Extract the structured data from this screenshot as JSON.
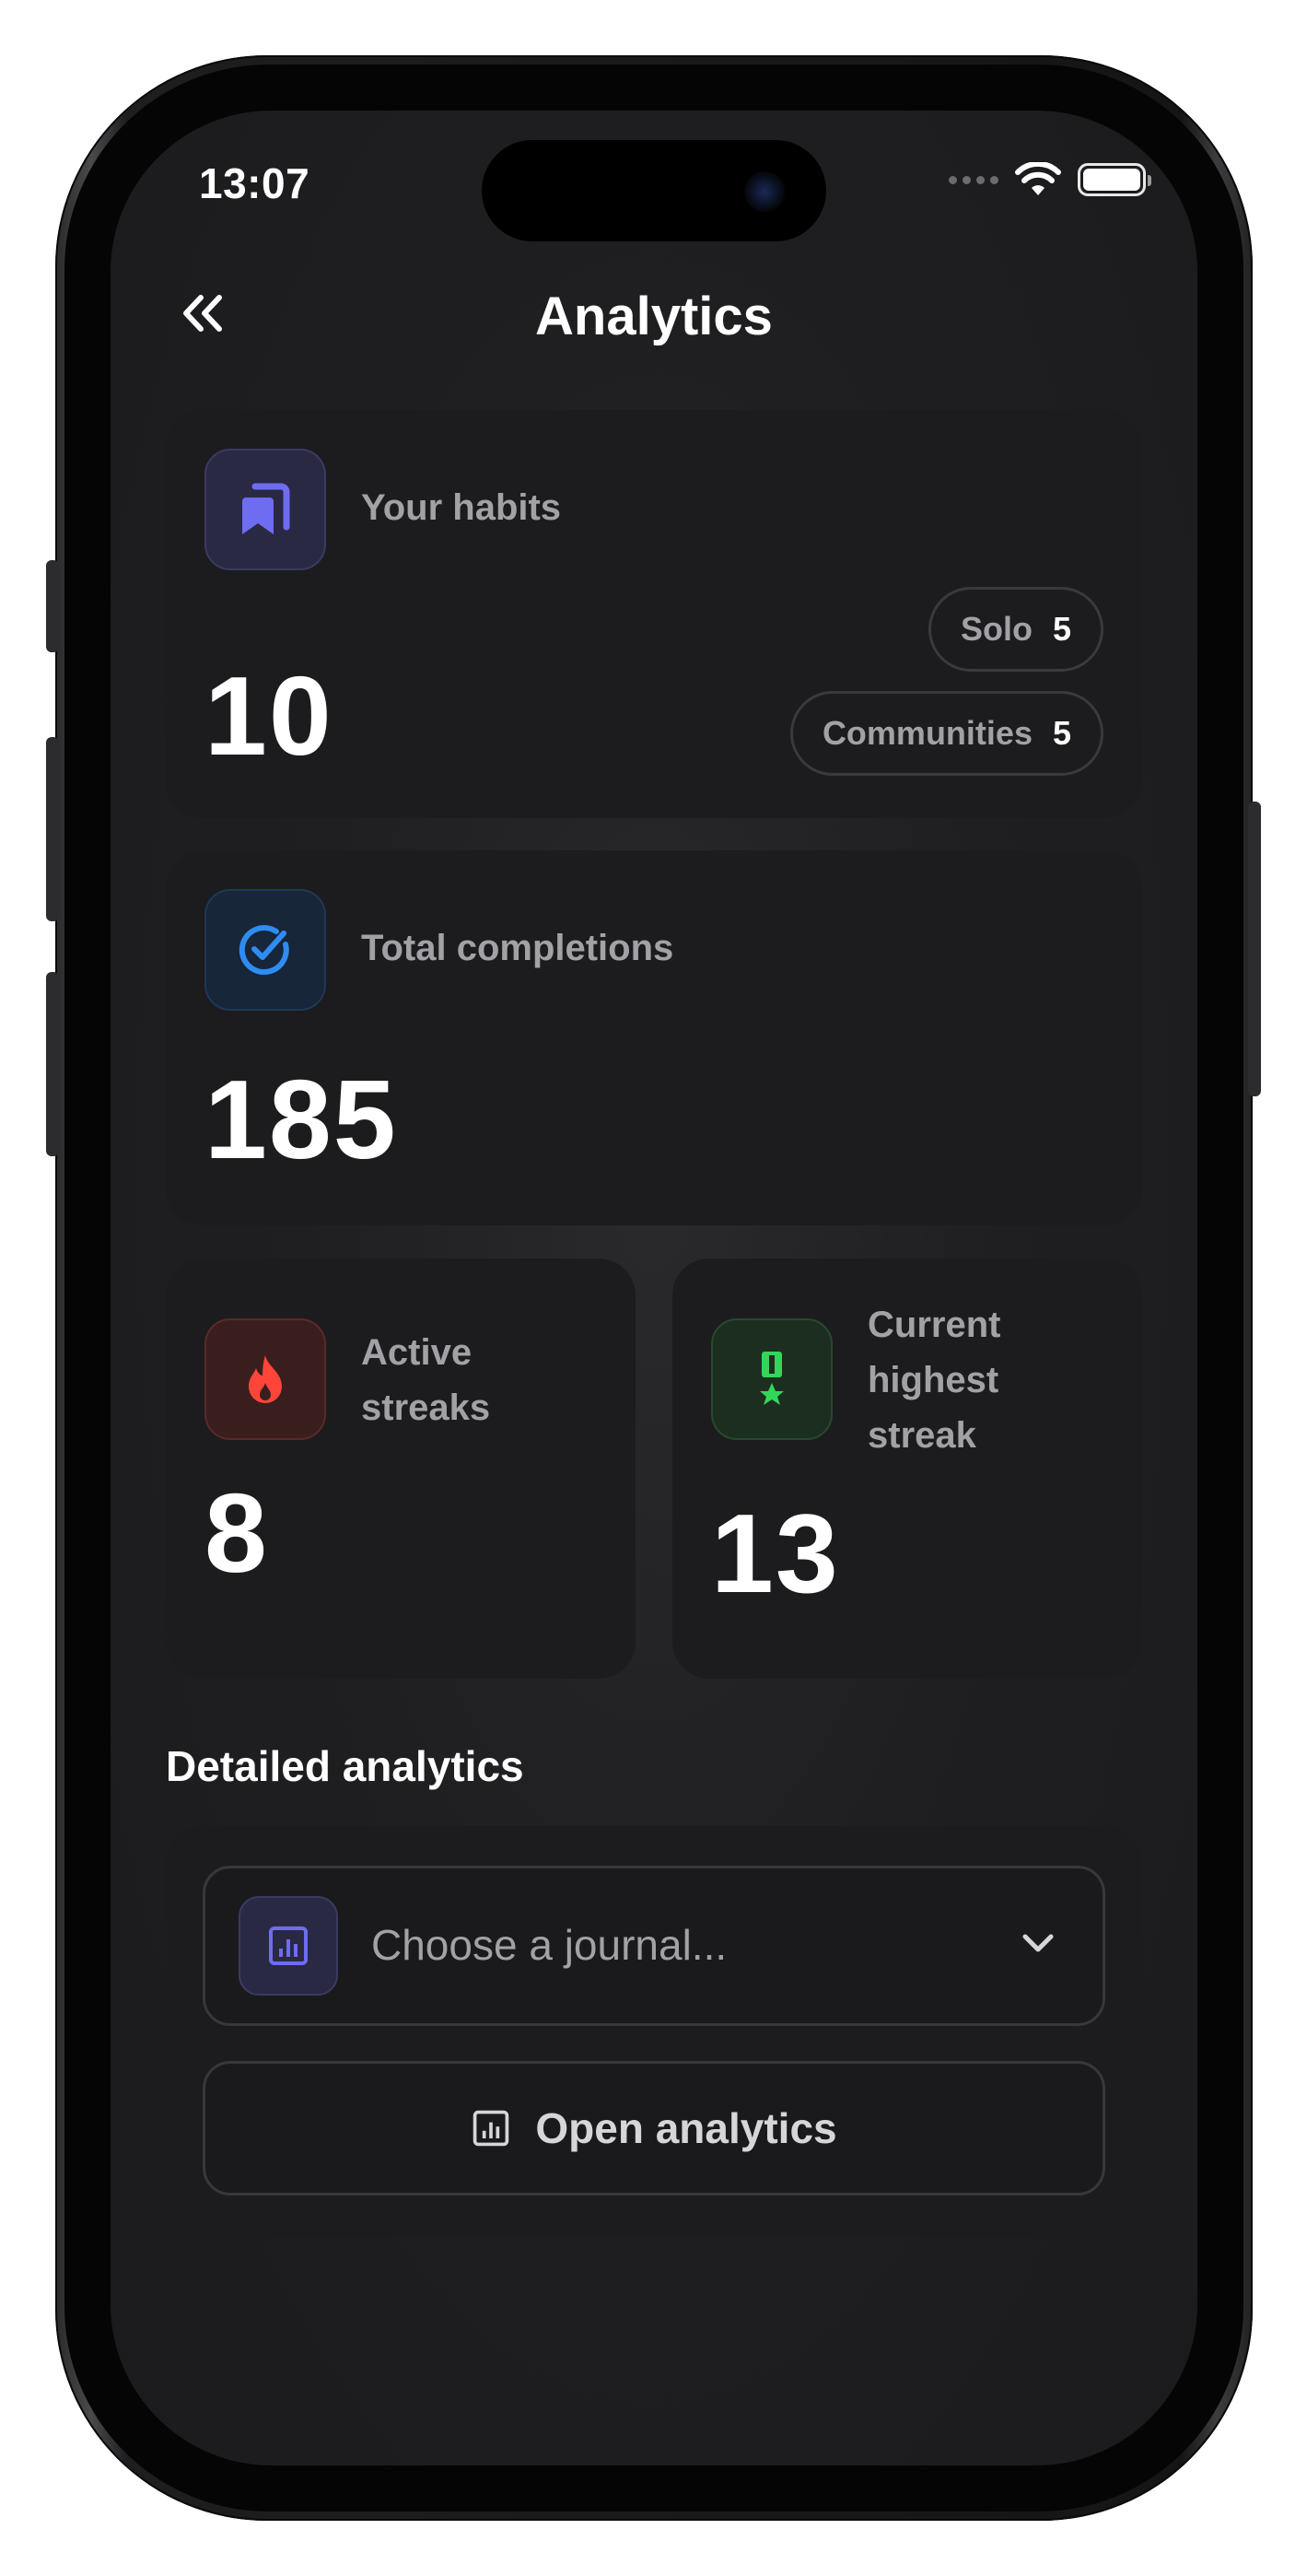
{
  "status_bar": {
    "time": "13:07"
  },
  "header": {
    "title": "Analytics",
    "back_icon": "double-chevron-left-icon"
  },
  "habits_card": {
    "label": "Your habits",
    "value": "10",
    "icon": "bookmark-stack-icon",
    "chips": [
      {
        "label": "Solo",
        "value": "5"
      },
      {
        "label": "Communities",
        "value": "5"
      }
    ]
  },
  "completions_card": {
    "label": "Total completions",
    "value": "185",
    "icon": "check-circle-icon"
  },
  "streaks_card": {
    "label": "Active streaks",
    "value": "8",
    "icon": "flame-icon"
  },
  "highest_card": {
    "label": "Current highest streak",
    "value": "13",
    "icon": "medal-icon"
  },
  "detailed": {
    "title": "Detailed analytics",
    "select_placeholder": "Choose a journal...",
    "select_icon": "chart-icon",
    "open_label": "Open analytics"
  },
  "colors": {
    "purple": "#6e6cf0",
    "blue": "#2f8cf2",
    "red": "#ff453a",
    "green": "#32d75a"
  }
}
